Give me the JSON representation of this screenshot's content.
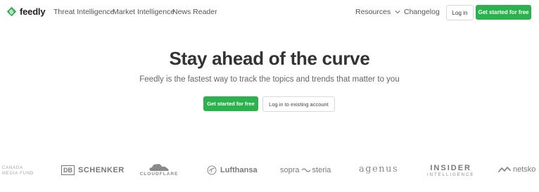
{
  "nav": {
    "brand": "feedly",
    "links": [
      "Threat Intelligence",
      "Market Intelligence",
      "News Reader"
    ],
    "resources": "Resources",
    "changelog": "Changelog",
    "login": "Log in",
    "cta": "Get started for free"
  },
  "hero": {
    "title": "Stay ahead of the curve",
    "subtitle": "Feedly is the fastest way to track the topics and trends that matter to you",
    "cta": "Get started for free",
    "login": "Log in to existing account"
  },
  "logos": {
    "cmf_line1": "CANADA",
    "cmf_line2": "MEDIA FUND",
    "db": "DB",
    "schenker": "SCHENKER",
    "cloudflare": "CLOUDFLARE",
    "lufthansa": "Lufthansa",
    "sopra_a": "sopra",
    "sopra_b": "steria",
    "agenus": "agenus",
    "insider_a": "INSIDER",
    "insider_b": "INTELLIGENCE",
    "netskope": "netsko"
  },
  "colors": {
    "brand_green": "#2bb24c",
    "text_dark": "#333333",
    "text_muted": "#666666",
    "logo_gray": "#8a8a8a"
  }
}
